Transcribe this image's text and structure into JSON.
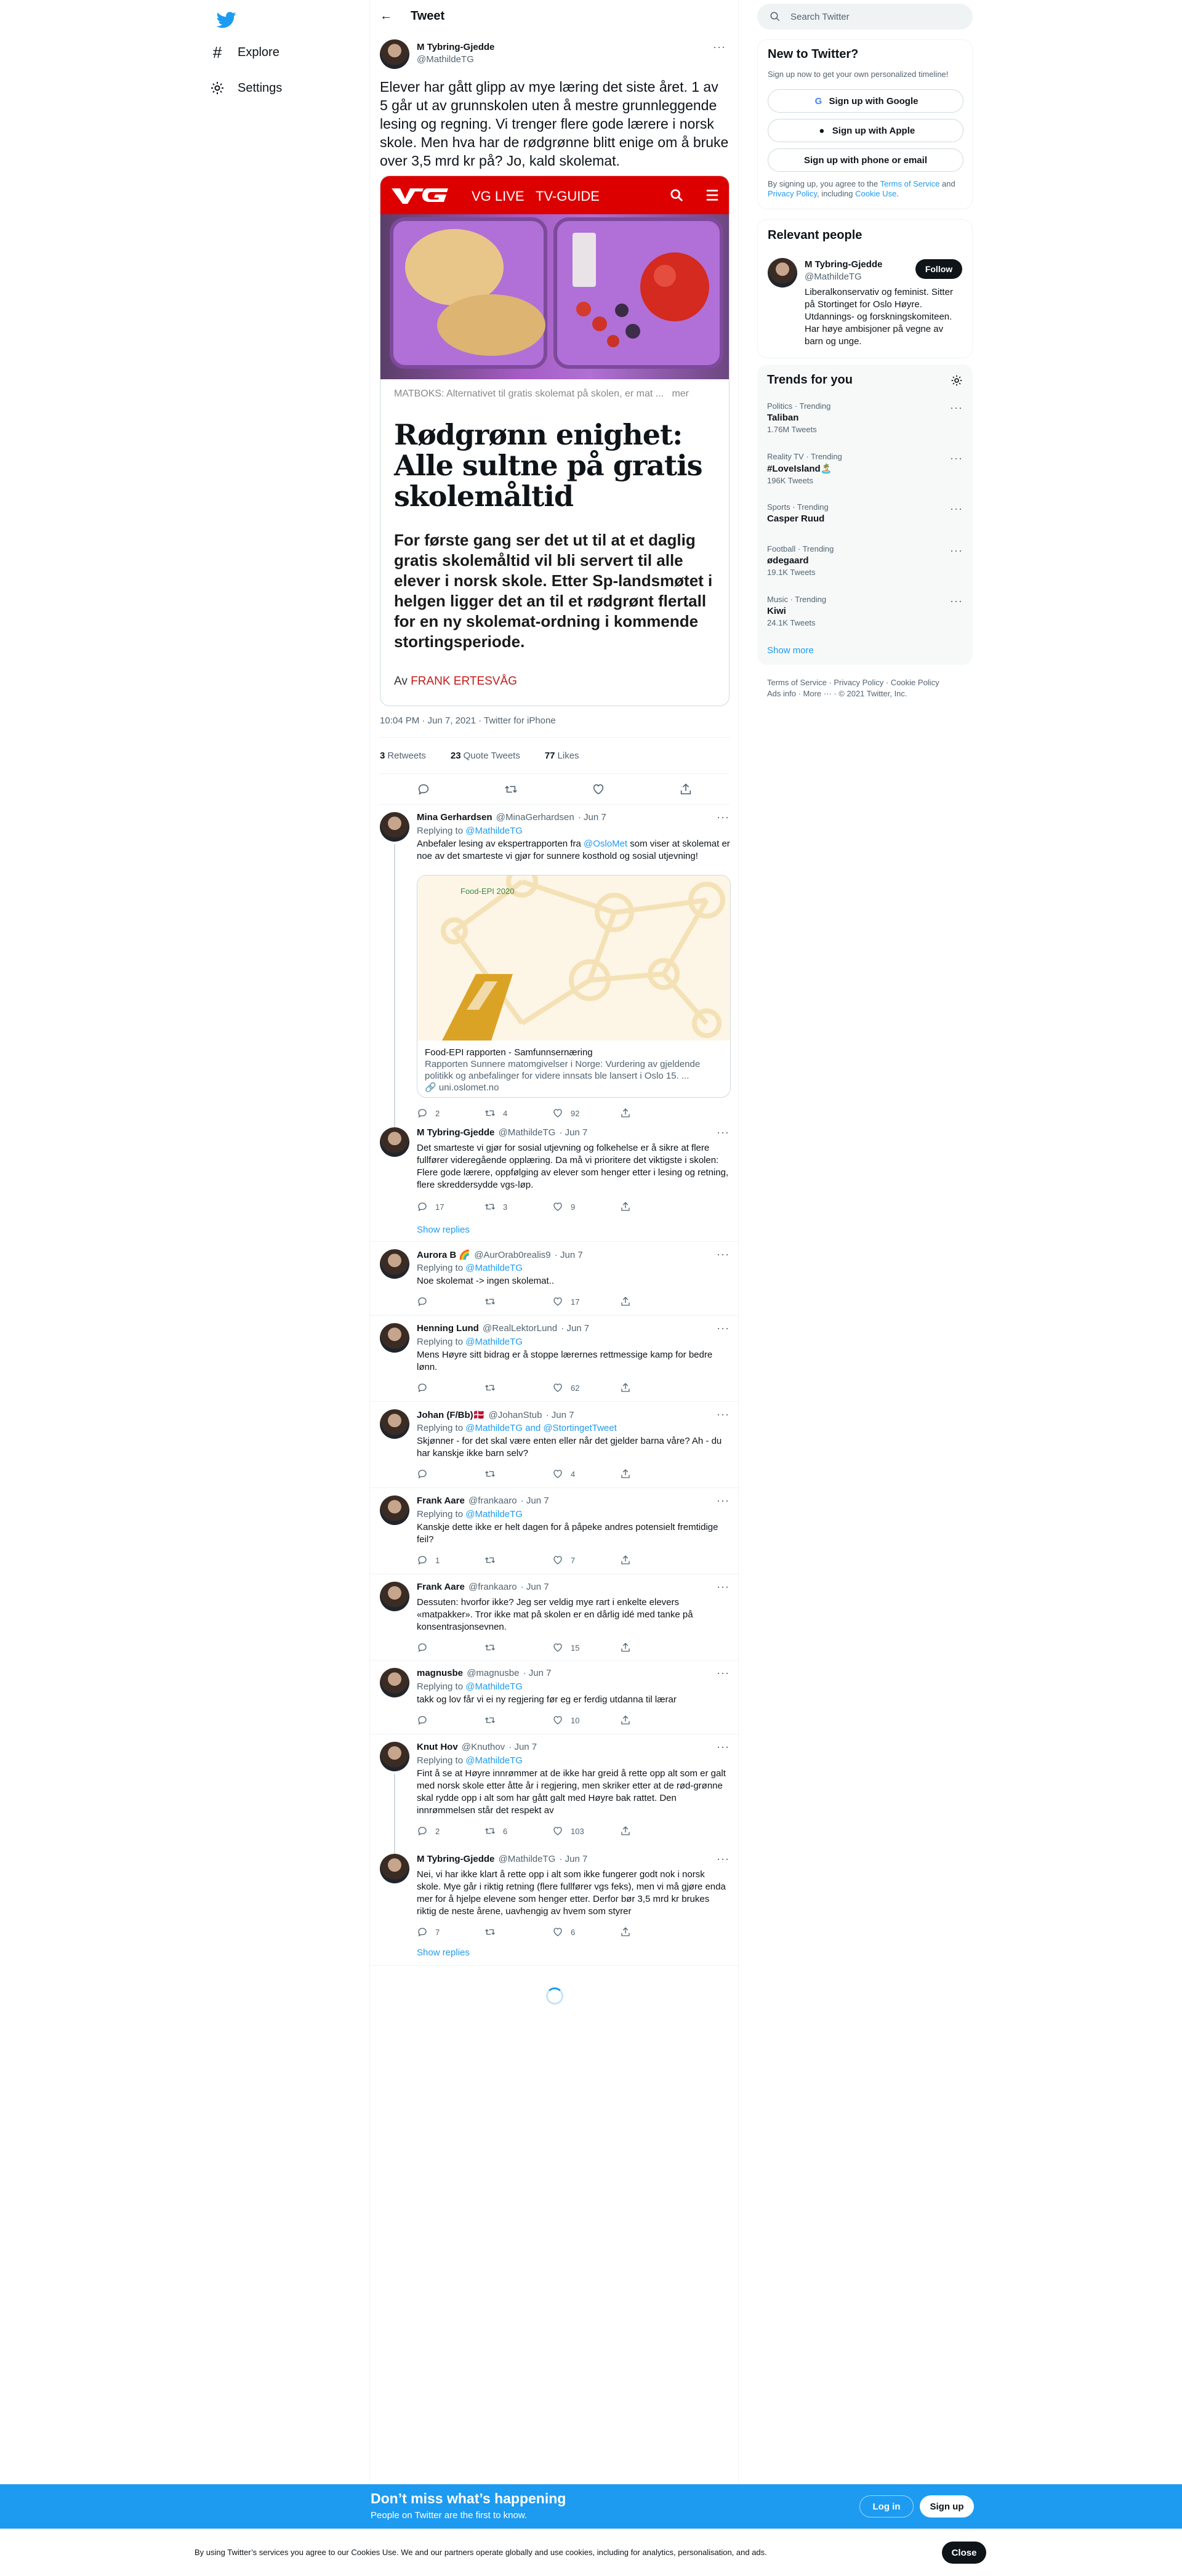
{
  "nav": {
    "logo": "twitter-bird-icon",
    "items": [
      {
        "label": "Explore",
        "icon": "hashtag-icon"
      },
      {
        "label": "Settings",
        "icon": "gear-icon"
      }
    ]
  },
  "header": {
    "title": "Tweet"
  },
  "tweet": {
    "name": "M Tybring-Gjedde",
    "handle": "@MathildeTG",
    "text": "Elever har gått glipp av mye læring det siste året. 1 av 5 går ut av grunnskolen uten å mestre grunnleggende lesing og regning. Vi trenger flere gode lærere i norsk skole. Men hva har de rødgrønne blitt enige om å bruke over 3,5 mrd kr på? Jo, kald skolemat.",
    "card": {
      "nav": [
        "VG LIVE",
        "TV-GUIDE"
      ],
      "caption": "MATBOKS: Alternativet til gratis skolemat på skolen, er mat ...",
      "caption_more": "mer",
      "headline": "Rødgrønn enighet: Alle sultne på gratis skolemåltid",
      "lead": "For første gang ser det ut til at et daglig gratis skolemåltid vil bli servert til alle elever i norsk skole. Etter Sp-landsmøtet i helgen ligger det an til et rødgrønt flertall for en ny skolemat-ordning i kommende stortingsperiode.",
      "author_prefix": "Av",
      "author": "FRANK ERTESVÅG"
    },
    "meta": "10:04 PM · Jun 7, 2021 · Twitter for iPhone",
    "stats": {
      "retweets": "3",
      "retweets_label": "Retweets",
      "quotes": "23",
      "quotes_label": "Quote Tweets",
      "likes": "77",
      "likes_label": "Likes"
    }
  },
  "replies": [
    {
      "name": "Mina Gerhardsen",
      "handle": "@MinaGerhardsen",
      "time": "· Jun 7",
      "replying": "Replying to",
      "to": "@MathildeTG",
      "text_before": "Anbefaler lesing av ekspertrapporten fra ",
      "mention": "@OsloMet",
      "text_after": " som viser at skolemat er noe av det smarteste vi gjør for sunnere kosthold og sosial utjevning!",
      "card": {
        "badge": "Food-EPI 2020",
        "title": "Food-EPI rapporten - Samfunnsernæring",
        "desc": "Rapporten Sunnere matomgivelser i Norge: Vurdering av gjeldende politikk og anbefalinger for videre innsats ble lansert i Oslo 15. ...",
        "domain": "uni.oslomet.no"
      },
      "reply_count": "2",
      "retweet_count": "4",
      "like_count": "92"
    },
    {
      "name": "M Tybring-Gjedde",
      "handle": "@MathildeTG",
      "time": "· Jun 7",
      "text": "Det smarteste vi gjør for sosial utjevning og folkehelse er å sikre at flere fullfører videregående opplæring. Da må vi prioritere det viktigste i skolen: Flere gode lærere, oppfølging av elever som henger etter i lesing og retning, flere skreddersydde vgs-løp.",
      "reply_count": "17",
      "retweet_count": "3",
      "like_count": "9",
      "show_replies": "Show replies"
    },
    {
      "name": "Aurora B 🌈",
      "handle": "@AurOrab0realis9",
      "time": "· Jun 7",
      "replying": "Replying to",
      "to": "@MathildeTG",
      "text": "Noe skolemat -> ingen skolemat..",
      "reply_count": "",
      "retweet_count": "",
      "like_count": "17"
    },
    {
      "name": "Henning Lund",
      "handle": "@RealLektorLund",
      "time": "· Jun 7",
      "replying": "Replying to",
      "to": "@MathildeTG",
      "text": "Mens Høyre sitt bidrag er å stoppe lærernes rettmessige kamp for bedre lønn.",
      "reply_count": "",
      "retweet_count": "",
      "like_count": "62"
    },
    {
      "name": "Johan (F/Bb)🇩🇰",
      "handle": "@JohanStub",
      "time": "· Jun 7",
      "replying": "Replying to",
      "to": "@MathildeTG and @StortingetTweet",
      "text": "Skjønner - for det skal være enten eller når det gjelder barna våre? Ah - du har kanskje ikke barn selv?",
      "reply_count": "",
      "retweet_count": "",
      "like_count": "4"
    },
    {
      "name": "Frank Aare",
      "handle": "@frankaaro",
      "time": "· Jun 7",
      "replying": "Replying to",
      "to": "@MathildeTG",
      "text": "Kanskje dette ikke er helt dagen for å påpeke andres potensielt fremtidige feil?",
      "reply_count": "1",
      "retweet_count": "",
      "like_count": "7"
    },
    {
      "name": "Frank Aare",
      "handle": "@frankaaro",
      "time": "· Jun 7",
      "text": "Dessuten: hvorfor ikke? Jeg ser veldig mye rart i enkelte elevers «matpakker». Tror ikke mat på skolen er en dårlig idé med tanke på konsentrasjonsevnen.",
      "reply_count": "",
      "retweet_count": "",
      "like_count": "15"
    },
    {
      "name": "magnusbe",
      "handle": "@magnusbe",
      "time": "· Jun 7",
      "replying": "Replying to",
      "to": "@MathildeTG",
      "text": "takk og lov får vi ei ny regjering før eg er ferdig utdanna til lærar",
      "reply_count": "",
      "retweet_count": "",
      "like_count": "10"
    },
    {
      "name": "Knut Hov",
      "handle": "@Knuthov",
      "time": "· Jun 7",
      "replying": "Replying to",
      "to": "@MathildeTG",
      "text": "Fint å se at Høyre innrømmer at de ikke har greid å rette opp alt som er galt med norsk skole etter åtte år i regjering, men skriker etter at de rød-grønne skal rydde opp i alt som har gått galt med Høyre bak rattet. Den innrømmelsen står det respekt av",
      "reply_count": "2",
      "retweet_count": "6",
      "like_count": "103"
    },
    {
      "name": "M Tybring-Gjedde",
      "handle": "@MathildeTG",
      "time": "· Jun 7",
      "text": "Nei, vi har ikke klart å rette opp i alt som ikke fungerer godt nok i norsk skole. Mye går i riktig retning (flere fullfører vgs feks), men vi må gjøre enda mer for å hjelpe elevene som henger etter. Derfor bør 3,5 mrd kr brukes riktig de neste årene, uavhengig av hvem som styrer",
      "reply_count": "7",
      "retweet_count": "",
      "like_count": "6",
      "show_replies": "Show replies"
    }
  ],
  "sidebar": {
    "search_placeholder": "Search Twitter",
    "new": {
      "title": "New to Twitter?",
      "subtitle": "Sign up now to get your own personalized timeline!",
      "google": "Sign up with Google",
      "apple": "Sign up with Apple",
      "phone": "Sign up with phone or email",
      "legal_1": "By signing up, you agree to the ",
      "tos": "Terms of Service",
      "legal_2": " and ",
      "privacy": "Privacy Policy",
      "legal_3": ", including ",
      "cookie": "Cookie Use",
      "legal_4": "."
    },
    "relevant": {
      "title": "Relevant people",
      "name": "M Tybring-Gjedde",
      "handle": "@MathildeTG",
      "follow": "Follow",
      "bio": "Liberalkonservativ og feminist. Sitter på Stortinget for Oslo Høyre. Utdannings- og forskningskomiteen. Har høye ambisjoner på vegne av barn og unge."
    },
    "trends": {
      "title": "Trends for you",
      "items": [
        {
          "context": "Politics · Trending",
          "name": "Taliban",
          "count": "1.76M Tweets"
        },
        {
          "context": "Reality TV · Trending",
          "name": "#LoveIsland🏝️",
          "count": "196K Tweets"
        },
        {
          "context": "Sports · Trending",
          "name": "Casper Ruud",
          "count": ""
        },
        {
          "context": "Football · Trending",
          "name": "ødegaard",
          "count": "19.1K Tweets"
        },
        {
          "context": "Music · Trending",
          "name": "Kiwi",
          "count": "24.1K Tweets"
        }
      ],
      "show_more": "Show more"
    },
    "footer": {
      "line1": "Terms of Service · Privacy Policy · Cookie Policy",
      "line2": "Ads info · More ··· · © 2021 Twitter, Inc."
    }
  },
  "bottom": {
    "title": "Don’t miss what’s happening",
    "subtitle": "People on Twitter are the first to know.",
    "login": "Log in",
    "signup": "Sign up"
  },
  "cookie": {
    "text": "By using Twitter’s services you agree to our Cookies Use. We and our partners operate globally and use cookies, including for analytics, personalisation, and ads.",
    "close": "Close"
  },
  "colors": {
    "accent": "#1d9bf0",
    "vg_red": "#dd0000",
    "text": "#0f1419",
    "muted": "#536471"
  }
}
